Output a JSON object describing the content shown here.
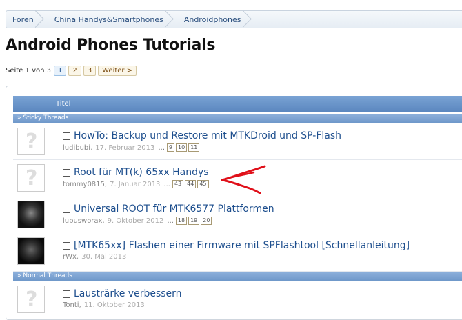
{
  "breadcrumb": [
    {
      "label": "Foren"
    },
    {
      "label": "China Handys&Smartphones"
    },
    {
      "label": "Androidphones"
    }
  ],
  "page_title": "Android Phones Tutorials",
  "pager": {
    "label": "Seite 1 von 3",
    "pages": [
      "1",
      "2",
      "3"
    ],
    "next": "Weiter >"
  },
  "table": {
    "title_header": "Titel",
    "sticky_label": "» Sticky Threads",
    "normal_label": "» Normal Threads"
  },
  "threads": [
    {
      "title": "HowTo: Backup und Restore mit MTKDroid und SP-Flash",
      "author": "ludibubi",
      "date": "17. Februar 2013",
      "dots": "...",
      "pages": [
        "9",
        "10",
        "11"
      ],
      "avatar": "placeholder"
    },
    {
      "title": "Root für MT(k) 65xx Handys",
      "author": "tommy0815",
      "date": "7. Januar 2013",
      "dots": "...",
      "pages": [
        "43",
        "44",
        "45"
      ],
      "avatar": "placeholder"
    },
    {
      "title": "Universal ROOT für MTK6577 Plattformen",
      "author": "lupusworax",
      "date": "9. Oktober 2012",
      "dots": "...",
      "pages": [
        "18",
        "19",
        "20"
      ],
      "avatar": "dark-figure"
    },
    {
      "title": "[MTK65xx] Flashen einer Firmware mit SPFlashtool [Schnellanleitung]",
      "author": "rWx",
      "date": "30. Mai 2013",
      "dots": "",
      "pages": [],
      "avatar": "dark-android"
    },
    {
      "title": "Lausträrke verbessern",
      "author": "Tonti",
      "date": "11. Oktober 2013",
      "dots": "",
      "pages": [],
      "avatar": "placeholder"
    }
  ],
  "colors": {
    "link": "#1e4f8e",
    "header": "#5b87bf",
    "annotation_arrow": "#e0101a"
  }
}
